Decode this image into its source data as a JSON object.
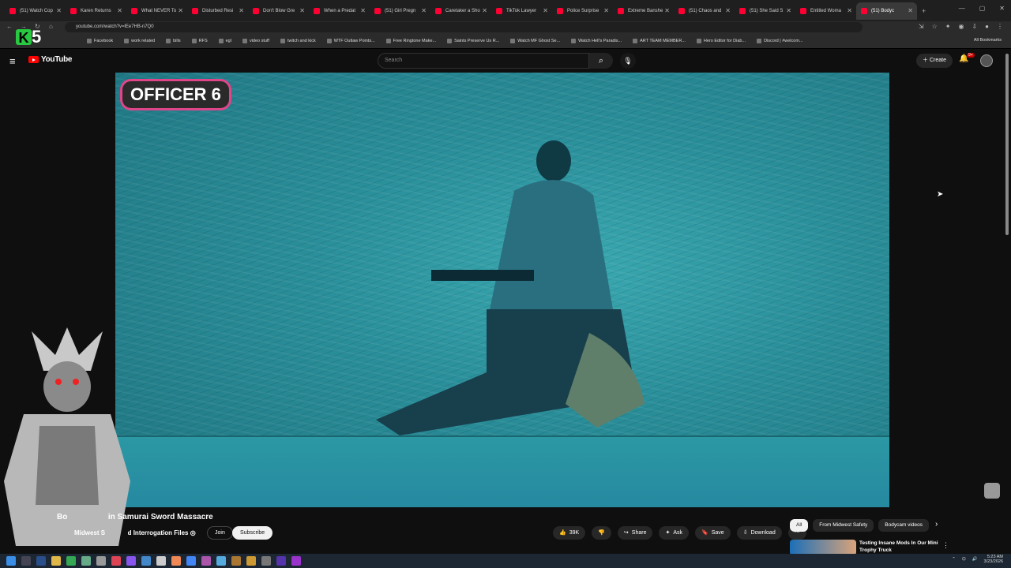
{
  "browser": {
    "tabs": [
      {
        "label": "(51) Watch Cop"
      },
      {
        "label": "Karen Returns"
      },
      {
        "label": "What NEVER To"
      },
      {
        "label": "Disturbed Resi"
      },
      {
        "label": "Don't Blow Gre"
      },
      {
        "label": "When a Predat"
      },
      {
        "label": "(51) Girl Pregn"
      },
      {
        "label": "Caretaker a Sho"
      },
      {
        "label": "TikTok Lawyer"
      },
      {
        "label": "Police Surprise"
      },
      {
        "label": "Extreme Banshe"
      },
      {
        "label": "(51) Chaos and"
      },
      {
        "label": "(51) She Said S"
      },
      {
        "label": "Entitled Woma"
      },
      {
        "label": "(51) Bodyc"
      }
    ],
    "url": "youtube.com/watch?v=lEe7HB-n7Q0",
    "bookmarks": [
      "Facebook",
      "work related",
      "bills",
      "RFS",
      "egl",
      "video stuff",
      "twitch and kick",
      "WTF Outlaw Points...",
      "Free Ringtone Make...",
      "Saints Preserve Us R...",
      "Watch MF Ghost Se...",
      "Watch Hell's Paradis...",
      "ART TEAM MEMBER...",
      "Hero Editor for Diab...",
      "Discord | #welcom..."
    ],
    "all_bookmarks": "All Bookmarks"
  },
  "overlay_logo": "5",
  "youtube": {
    "logo_text": "YouTube",
    "search_placeholder": "Search",
    "create_label": "Create",
    "notif_badge": "9+"
  },
  "video": {
    "badge_text": "OFFICER 6"
  },
  "below": {
    "title_left": "Bo",
    "title_right": "in Samurai Sword Massacre",
    "channel_left": "Midwest S",
    "channel_right": "d Interrogation Files",
    "join_label": "Join",
    "subscribe_label": "Subscribe",
    "likes": "39K",
    "share_label": "Share",
    "ask_label": "Ask",
    "save_label": "Save",
    "download_label": "Download"
  },
  "sidebar": {
    "chips": [
      "All",
      "From Midwest Safety",
      "Bodycam videos"
    ],
    "rec_title": "Testing Insane Mods In Our Mini Trophy Truck"
  },
  "tray": {
    "time": "5:23 AM",
    "date": "3/23/2026"
  }
}
